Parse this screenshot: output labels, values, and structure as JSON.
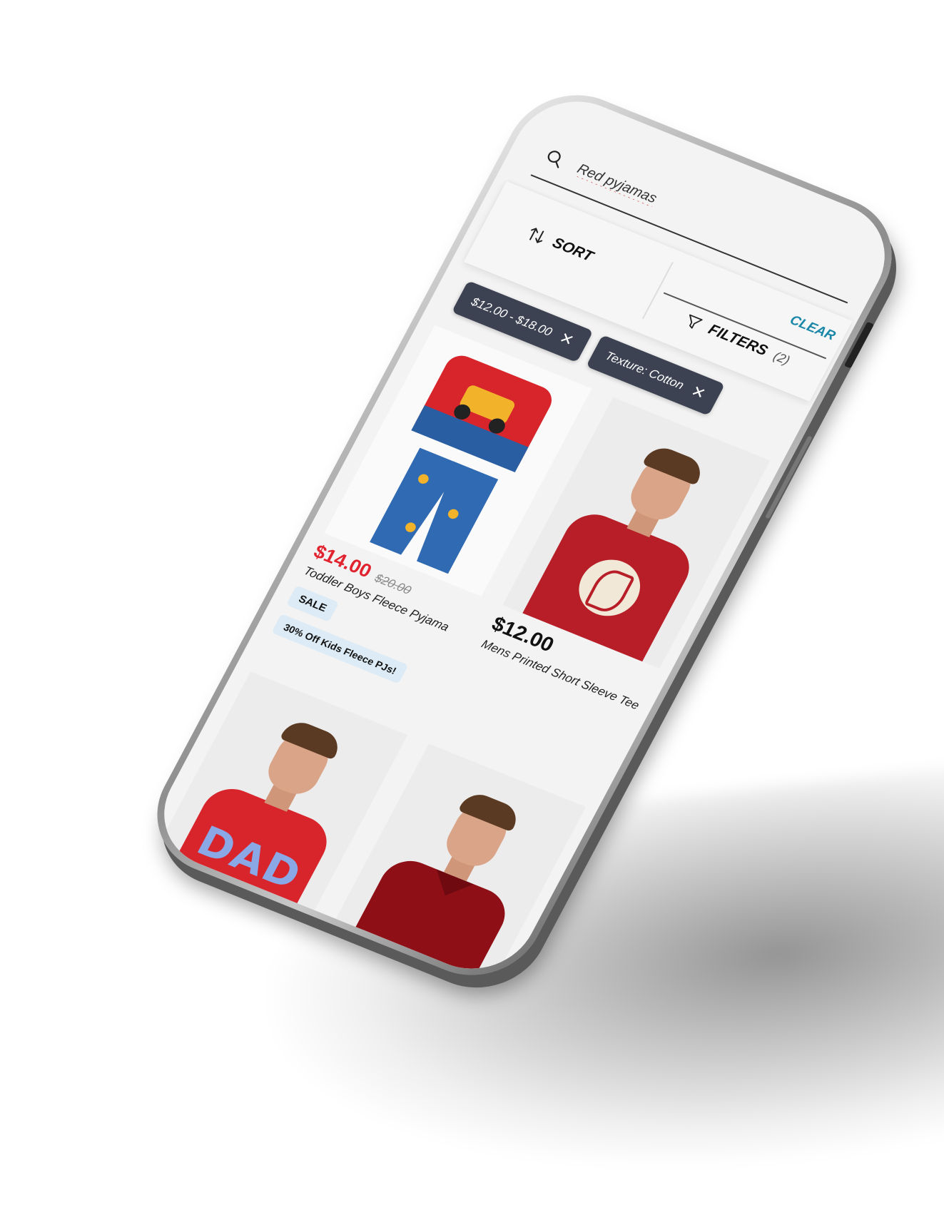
{
  "search": {
    "query": "Red pyjamas"
  },
  "toolbar": {
    "sort_label": "SORT",
    "clear_label": "CLEAR",
    "filters_label": "FILTERS",
    "filters_count": "(2)"
  },
  "chips": [
    {
      "label": "$12.00 - $18.00",
      "remove_glyph": "✕"
    },
    {
      "label": "Texture: Cotton",
      "remove_glyph": "✕"
    }
  ],
  "products": [
    {
      "price": "$14.00",
      "old_price": "$20.00",
      "name": "Toddler Boys Fleece Pyjama",
      "badges": [
        "SALE",
        "30% Off Kids Fleece PJs!"
      ]
    },
    {
      "price": "$12.00",
      "name": "Mens Printed Short Sleeve Tee"
    },
    {
      "image_text": "DAD"
    },
    {}
  ],
  "colors": {
    "sale_price": "#e0232e",
    "clear_link": "#1a87a8",
    "chip_bg": "#3c4252",
    "badge_bg": "#dcebf5"
  },
  "icons": {
    "search": "search-icon",
    "sort": "sort-arrows-icon",
    "filter": "filter-funnel-icon",
    "remove": "close-icon"
  }
}
